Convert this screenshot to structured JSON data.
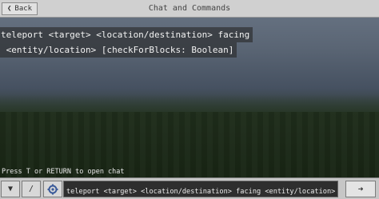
{
  "header": {
    "title": "Chat and Commands",
    "back_label": "Back",
    "back_icon": "left-chevron-icon"
  },
  "chat": {
    "lines": [
      "teleport <target> <location/destination> facing",
      " <entity/location> [checkForBlocks: Boolean]"
    ]
  },
  "hint": "Press T or RETURN to open chat",
  "toolbar": {
    "menu_icon": "chevron-down-icon",
    "slash_label": "/",
    "settings_icon": "settings-gear-icon",
    "input_value": "teleport <target> <location/destination> facing <entity/location> [ch",
    "send_icon": "send-arrow-icon"
  }
}
